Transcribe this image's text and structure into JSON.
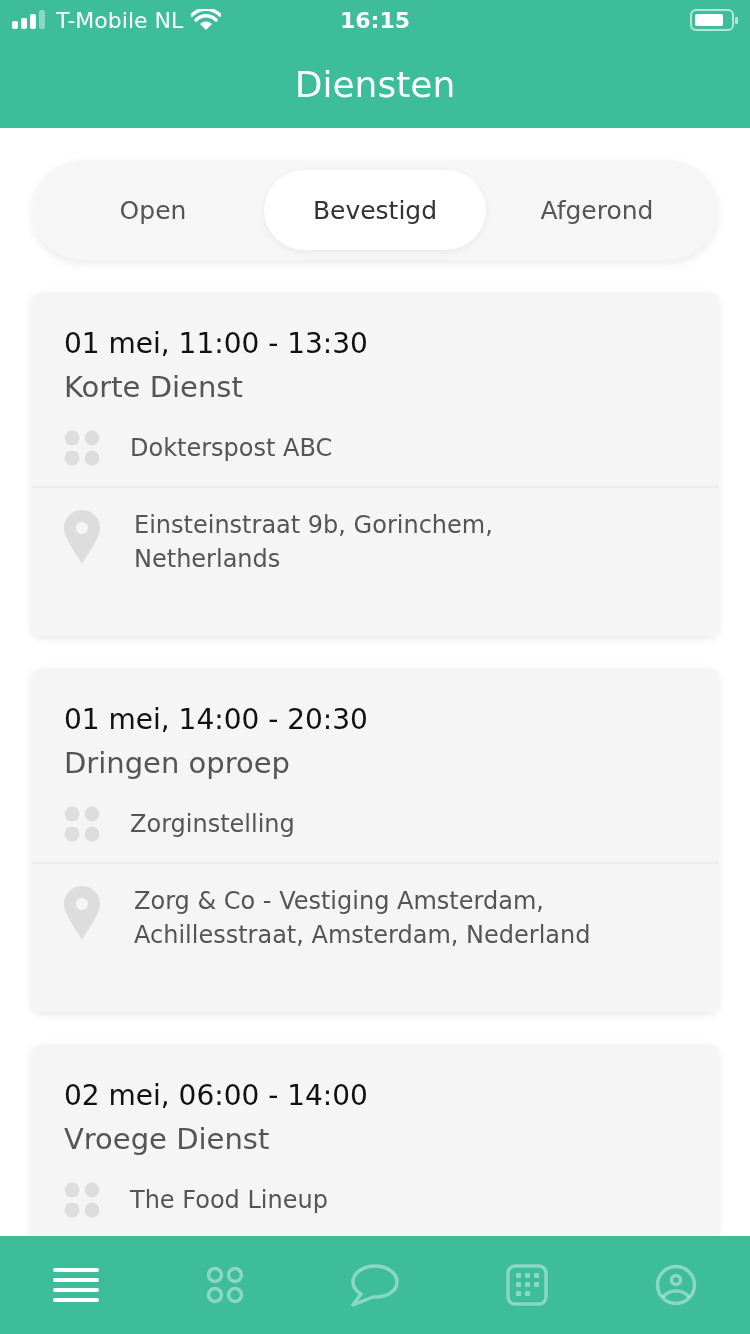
{
  "status_bar": {
    "carrier": "T-Mobile NL",
    "time": "16:15"
  },
  "header": {
    "title": "Diensten"
  },
  "segments": [
    {
      "label": "Open",
      "selected": false
    },
    {
      "label": "Bevestigd",
      "selected": true
    },
    {
      "label": "Afgerond",
      "selected": false
    }
  ],
  "shifts": [
    {
      "time": "01 mei, 11:00 - 13:30",
      "title": "Korte Dienst",
      "organisation": "Dokterspost ABC",
      "address": "Einsteinstraat 9b, Gorinchem, Netherlands"
    },
    {
      "time": "01 mei, 14:00 - 20:30",
      "title": "Dringen oproep",
      "organisation": "Zorginstelling",
      "address": "Zorg & Co - Vestiging Amsterdam, Achillesstraat, Amsterdam, Nederland"
    },
    {
      "time": "02 mei, 06:00 - 14:00",
      "title": "Vroege Dienst",
      "organisation": "The Food Lineup"
    }
  ],
  "tab_bar": [
    {
      "kind": "menu",
      "selected": true
    },
    {
      "kind": "grid",
      "selected": false
    },
    {
      "kind": "chat",
      "selected": false
    },
    {
      "kind": "keypad",
      "selected": false
    },
    {
      "kind": "profile",
      "selected": false
    }
  ]
}
